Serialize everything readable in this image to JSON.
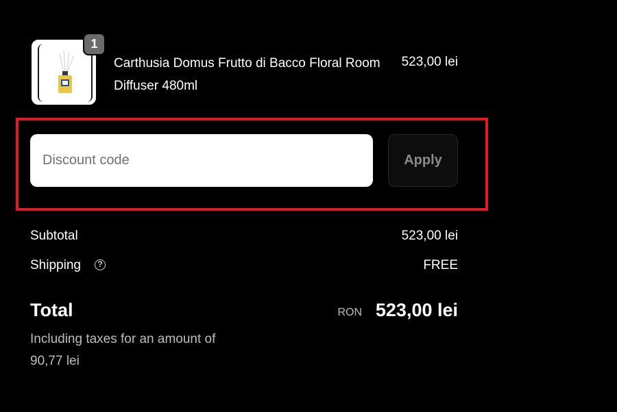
{
  "product": {
    "name": "Carthusia Domus Frutto di Bacco Floral Room Diffuser 480ml",
    "price": "523,00 lei",
    "quantity": "1"
  },
  "discount": {
    "placeholder": "Discount code",
    "value": "",
    "apply_label": "Apply"
  },
  "summary": {
    "subtotal_label": "Subtotal",
    "subtotal_value": "523,00 lei",
    "shipping_label": "Shipping",
    "shipping_value": "FREE",
    "shipping_help_icon": "question-circle-icon"
  },
  "total": {
    "label": "Total",
    "currency": "RON",
    "value": "523,00 lei",
    "tax_note": "Including taxes for an amount of 90,77 lei"
  },
  "colors": {
    "background": "#000000",
    "highlight": "#e01b24",
    "muted_text": "#bdbdbd",
    "apply_text": "#8a8a8a"
  }
}
